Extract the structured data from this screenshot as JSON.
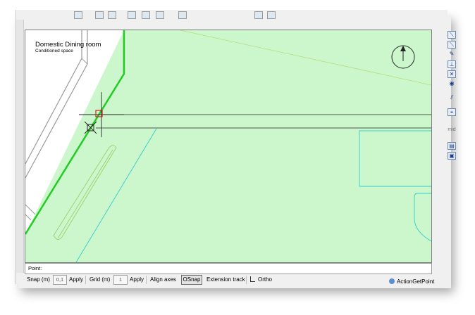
{
  "room": {
    "name": "Domestic Dining room",
    "subtitle": "Conditioned space"
  },
  "point_bar": {
    "label": "Point:"
  },
  "status_bar": {
    "snap_label": "Snap (m)",
    "snap_value": "0,1",
    "apply1": "Apply",
    "grid_label": "Grid (m)",
    "grid_value": "1",
    "apply2": "Apply",
    "align_axes": "Align axes",
    "osnap": "OSnap",
    "extension_track": "Extension track",
    "ortho": "Ortho"
  },
  "action_status": {
    "label": "ActionGetPoint"
  },
  "right_toolbar": {
    "mid_label": "mid"
  },
  "colors": {
    "canvas_bg": "#ccf7cc",
    "room_boundary": "#22cc22",
    "cyan_lines": "#33cccc",
    "snap_marker": "#cc2222"
  }
}
